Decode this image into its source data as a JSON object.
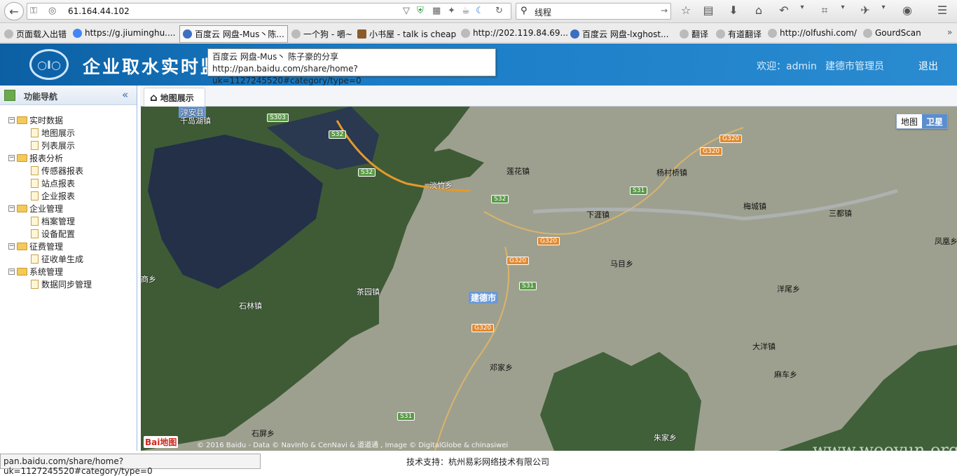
{
  "browser": {
    "url": "61.164.44.102",
    "search_query": "线程",
    "bookmarks": [
      "页面载入出错",
      "https://g.jiuminghu....",
      "百度云 网盘-Mus丶陈...",
      "一个狗 - 嚼~",
      "小书屋 - talk is cheap",
      "http://202.119.84.69...",
      "百度云 网盘-lxghost...",
      "翻译",
      "有道翻译",
      "http://olfushi.com/",
      "GourdScan"
    ],
    "tooltip": {
      "title": "百度云 网盘-Mus丶 陈子豪的分享",
      "url": "http://pan.baidu.com/share/home?uk=1127245520#category/type=0"
    },
    "status_url": "pan.baidu.com/share/home?uk=1127245520#category/type=0"
  },
  "header": {
    "title": "企业取水实时监",
    "welcome": "欢迎：admin",
    "role": "建德市管理员",
    "logout": "退出"
  },
  "sidebar": {
    "title": "功能导航",
    "collapse_icon": "double-chevron-left-icon",
    "groups": [
      {
        "label": "实时数据",
        "items": [
          "地图展示",
          "列表展示"
        ]
      },
      {
        "label": "报表分析",
        "items": [
          "传感器报表",
          "站点报表",
          "企业报表"
        ]
      },
      {
        "label": "企业管理",
        "items": [
          "档案管理",
          "设备配置"
        ]
      },
      {
        "label": "征费管理",
        "items": [
          "征收单生成"
        ]
      },
      {
        "label": "系统管理",
        "items": [
          "数据同步管理"
        ]
      }
    ]
  },
  "main": {
    "tab_label": "地图展示",
    "map": {
      "type_map": "地图",
      "type_satellite": "卫星",
      "places": [
        "淳安县",
        "千岛湖镇",
        "淡竹乡",
        "莲花镇",
        "杨村桥镇",
        "梅城镇",
        "三都镇",
        "下涯镇",
        "凤凰乡",
        "马目乡",
        "商乡",
        "茶园镇",
        "石林镇",
        "建德市",
        "洋尾乡",
        "大洋镇",
        "邓家乡",
        "麻车乡",
        "石屏乡",
        "朱家乡"
      ],
      "roads": [
        "S303",
        "S32",
        "S32",
        "G320",
        "G320",
        "S31",
        "S32",
        "G320",
        "G320",
        "S31",
        "G320",
        "S31"
      ],
      "copyright": "© 2016 Baidu - Data © NavInfo & CenNavi & 道道通 , Image © DigitalGlobe & chinasiwei",
      "logo_text": "Bai地图"
    }
  },
  "footer": {
    "support": "技术支持：杭州易彩网络技术有限公司",
    "watermark": "www.wooyun.org"
  }
}
